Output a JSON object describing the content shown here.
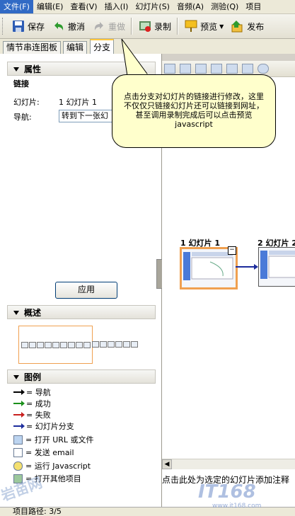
{
  "menu": [
    {
      "label": "文件(F)",
      "active": true
    },
    {
      "label": "编辑(E)"
    },
    {
      "label": "查看(V)"
    },
    {
      "label": "插入(I)"
    },
    {
      "label": "幻灯片(S)"
    },
    {
      "label": "音频(A)"
    },
    {
      "label": "测验(Q)"
    },
    {
      "label": "项目"
    }
  ],
  "toolbar": {
    "save": "保存",
    "undo": "撤消",
    "redo": "重做",
    "record": "录制",
    "preview": "预览",
    "publish": "发布"
  },
  "tabs": {
    "storyboard": "情节串连图板",
    "edit": "编辑",
    "branch": "分支"
  },
  "properties": {
    "title": "属性",
    "group": "链接",
    "slide_label": "幻灯片:",
    "slide_value": "1 幻灯片 1",
    "nav_label": "导航:",
    "nav_value": "转到下一张幻",
    "apply": "应用"
  },
  "overview": {
    "title": "概述"
  },
  "legend": {
    "title": "图例",
    "items": [
      {
        "label": "= 导航",
        "color": "#000000"
      },
      {
        "label": "= 成功",
        "color": "#1a8f1a"
      },
      {
        "label": "= 失败",
        "color": "#c8201e"
      },
      {
        "label": "= 幻灯片分支",
        "color": "#1c2c9c"
      }
    ],
    "icons": [
      {
        "label": "= 打开 URL 或文件",
        "icon": "globe-icon"
      },
      {
        "label": "= 发送 email",
        "icon": "email-icon"
      },
      {
        "label": "= 运行 Javascript",
        "icon": "script-icon"
      },
      {
        "label": "= 打开其他项目",
        "icon": "project-icon"
      }
    ]
  },
  "branch": {
    "slide1": "1 幻灯片 1",
    "slide2": "2 幻灯片 2",
    "status": "点击此处为选定的幻灯片添加注释"
  },
  "callout": "点击分支对幻灯片的链接进行修改，这里不仅仅只链接幻灯片还可以链接到网址，甚至调用录制完成后可以点击预览javascript",
  "bottom_status": "项目路径: 3/5",
  "watermark": {
    "left": "岩苗网",
    "right": "IT168",
    "sub": "www.it168.com"
  },
  "colors": {
    "accent": "#f0a050",
    "callout_bg": "#ffffcc",
    "menu_active": "#316ac5"
  }
}
